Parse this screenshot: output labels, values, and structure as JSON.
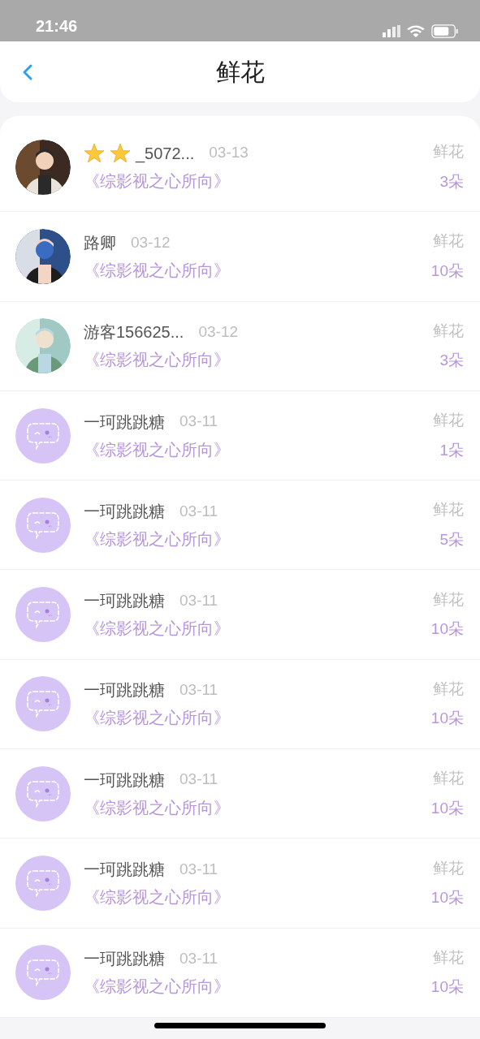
{
  "status_bar": {
    "time": "21:46"
  },
  "header": {
    "title": "鲜花"
  },
  "items": [
    {
      "name_icons": [
        {
          "kind": "star"
        },
        {
          "kind": "star"
        }
      ],
      "name": "_5072...",
      "date": "03-13",
      "book": "《综影视之心所向》",
      "label": "鲜花",
      "count": "3朵"
    },
    {
      "name": "路卿",
      "date": "03-12",
      "book": "《综影视之心所向》",
      "label": "鲜花",
      "count": "10朵"
    },
    {
      "name": "游客156625...",
      "date": "03-12",
      "book": "《综影视之心所向》",
      "label": "鲜花",
      "count": "3朵"
    },
    {
      "avatar": {
        "kind": "default"
      },
      "name": "一珂跳跳糖",
      "date": "03-11",
      "book": "《综影视之心所向》",
      "label": "鲜花",
      "count": "1朵"
    },
    {
      "avatar": {
        "kind": "default"
      },
      "name": "一珂跳跳糖",
      "date": "03-11",
      "book": "《综影视之心所向》",
      "label": "鲜花",
      "count": "5朵"
    },
    {
      "avatar": {
        "kind": "default"
      },
      "name": "一珂跳跳糖",
      "date": "03-11",
      "book": "《综影视之心所向》",
      "label": "鲜花",
      "count": "10朵"
    },
    {
      "avatar": {
        "kind": "default"
      },
      "name": "一珂跳跳糖",
      "date": "03-11",
      "book": "《综影视之心所向》",
      "label": "鲜花",
      "count": "10朵"
    },
    {
      "avatar": {
        "kind": "default"
      },
      "name": "一珂跳跳糖",
      "date": "03-11",
      "book": "《综影视之心所向》",
      "label": "鲜花",
      "count": "10朵"
    },
    {
      "avatar": {
        "kind": "default"
      },
      "name": "一珂跳跳糖",
      "date": "03-11",
      "book": "《综影视之心所向》",
      "label": "鲜花",
      "count": "10朵"
    },
    {
      "avatar": {
        "kind": "default"
      },
      "name": "一珂跳跳糖",
      "date": "03-11",
      "book": "《综影视之心所向》",
      "label": "鲜花",
      "count": "10朵"
    }
  ]
}
